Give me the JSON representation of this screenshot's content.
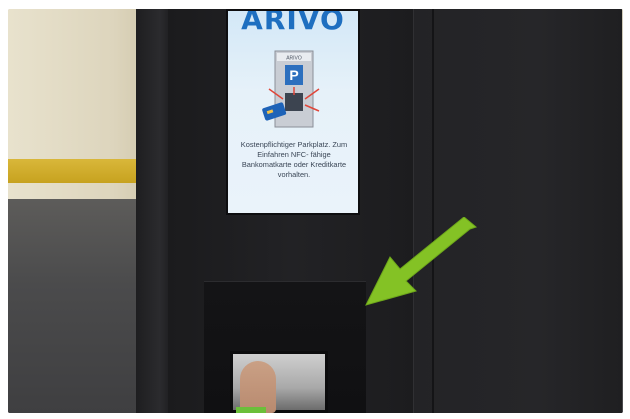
{
  "screen": {
    "brand": "ARIVO",
    "instruction_lines": [
      "Kostenpflichtiger Parkplatz. Zum",
      "Einfahren NFC- fähige",
      "Bankomatkarte oder Kreditkarte",
      "vorhalten."
    ]
  },
  "illustration": {
    "kiosk_label": "ARIVO",
    "parking_sign": "P"
  },
  "colors": {
    "arrow": "#84c225",
    "brand_blue": "#1e6fc0",
    "screen_bg": "#e6f1f9",
    "yellow_stripe": "#d4b02c"
  }
}
